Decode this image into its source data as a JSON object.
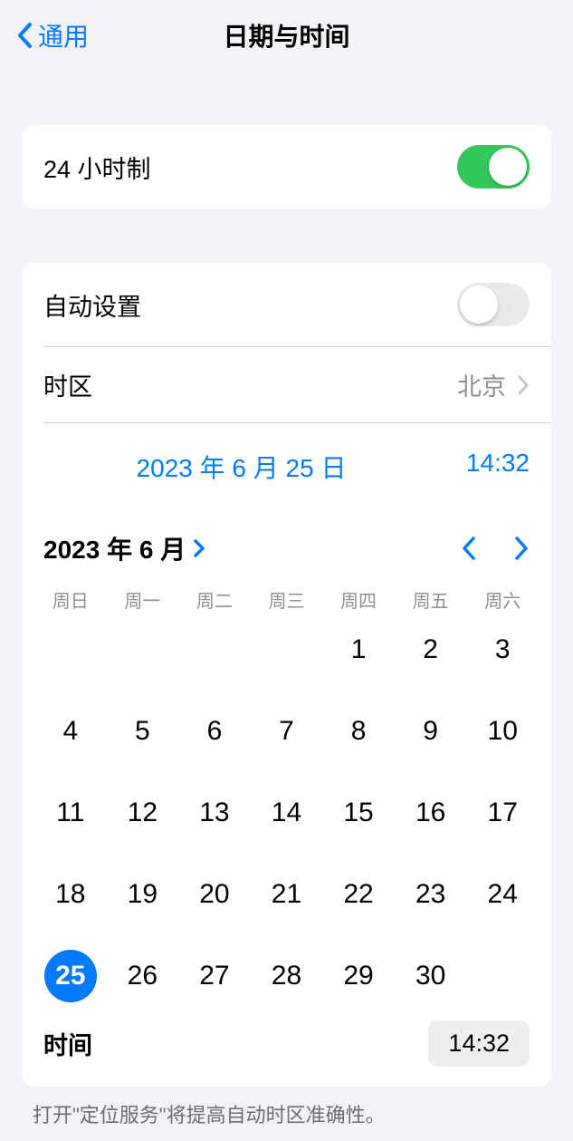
{
  "header": {
    "back_label": "通用",
    "title": "日期与时间"
  },
  "toggle_24h": {
    "label": "24 小时制",
    "on": true
  },
  "auto_set": {
    "label": "自动设置",
    "on": false
  },
  "timezone": {
    "label": "时区",
    "value": "北京"
  },
  "datetime": {
    "date": "2023 年 6 月 25 日",
    "time": "14:32"
  },
  "calendar": {
    "month_label": "2023 年 6 月",
    "weekdays": [
      "周日",
      "周一",
      "周二",
      "周三",
      "周四",
      "周五",
      "周六"
    ],
    "leading_blanks": 4,
    "days_in_month": 30,
    "selected_day": 25
  },
  "time_row": {
    "label": "时间",
    "value": "14:32"
  },
  "footer_note": "打开\"定位服务\"将提高自动时区准确性。"
}
